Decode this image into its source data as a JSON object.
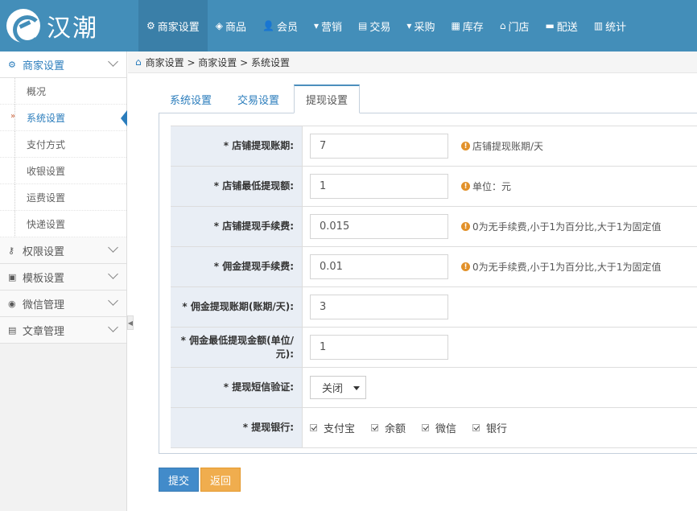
{
  "brand": {
    "name": "汉潮"
  },
  "nav": [
    {
      "icon": "⚙",
      "label": "商家设置",
      "active": true
    },
    {
      "icon": "◈",
      "label": "商品"
    },
    {
      "icon": "👤",
      "label": "会员"
    },
    {
      "icon": "▾",
      "label": "营销"
    },
    {
      "icon": "▤",
      "label": "交易"
    },
    {
      "icon": "▾",
      "label": "采购"
    },
    {
      "icon": "▦",
      "label": "库存"
    },
    {
      "icon": "⌂",
      "label": "门店"
    },
    {
      "icon": "▬",
      "label": "配送"
    },
    {
      "icon": "▥",
      "label": "统计"
    }
  ],
  "sidebar": {
    "group_open": {
      "label": "商家设置",
      "icon": "⚙"
    },
    "subitems": [
      "概况",
      "系统设置",
      "支付方式",
      "收银设置",
      "运费设置",
      "快递设置"
    ],
    "groups": [
      {
        "label": "权限设置",
        "icon": "⚷"
      },
      {
        "label": "模板设置",
        "icon": "▣"
      },
      {
        "label": "微信管理",
        "icon": "◉"
      },
      {
        "label": "文章管理",
        "icon": "▤"
      }
    ]
  },
  "breadcrumb": "商家设置 > 商家设置 > 系统设置",
  "tabs": [
    "系统设置",
    "交易设置",
    "提现设置"
  ],
  "form": {
    "rows": [
      {
        "label": "* 店铺提现账期:",
        "value": "7",
        "hint": "店铺提现账期/天"
      },
      {
        "label": "* 店铺最低提现额:",
        "value": "1",
        "hint": "单位：元"
      },
      {
        "label": "* 店铺提现手续费:",
        "value": "0.015",
        "hint": "0为无手续费,小于1为百分比,大于1为固定值"
      },
      {
        "label": "* 佣金提现手续费:",
        "value": "0.01",
        "hint": "0为无手续费,小于1为百分比,大于1为固定值"
      },
      {
        "label": "* 佣金提现账期(账期/天):",
        "value": "3"
      },
      {
        "label": "* 佣金最低提现金额(单位/元):",
        "value": "1"
      }
    ],
    "sms": {
      "label": "* 提现短信验证:",
      "value": "关闭"
    },
    "banks": {
      "label": "* 提现银行:",
      "options": [
        "支付宝",
        "余额",
        "微信",
        "银行"
      ]
    }
  },
  "buttons": {
    "submit": "提交",
    "back": "返回"
  }
}
